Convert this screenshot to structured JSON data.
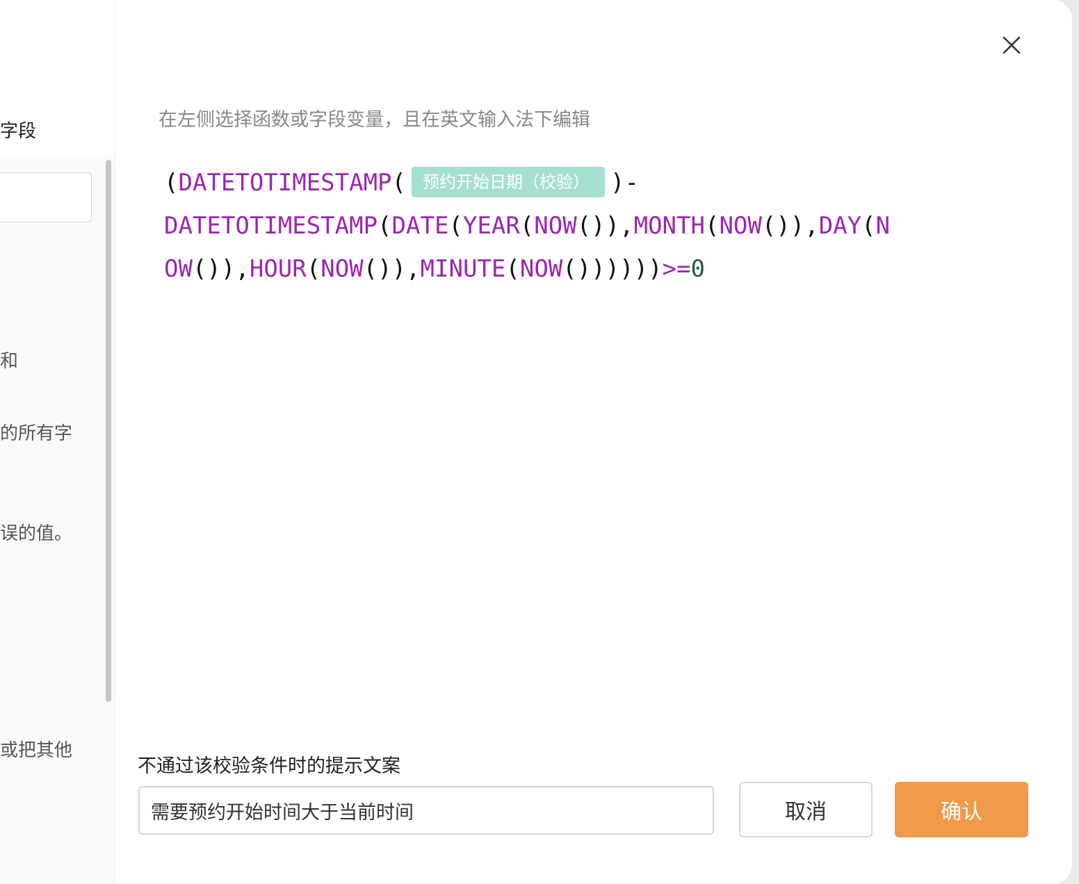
{
  "left": {
    "title_partial": "字段",
    "text_1": "和",
    "text_2": "的所有字",
    "text_3": "误的值。",
    "text_4": "或把其他"
  },
  "hint": "在左侧选择函数或字段变量，且在英文输入法下编辑",
  "formula": {
    "line1": {
      "open": "(",
      "fn": "DATETOTIMESTAMP",
      "paren": "(",
      "field_chip": "预约开始日期（校验）",
      "close": ")",
      "minus": "-"
    },
    "line2": {
      "f1": "DATETOTIMESTAMP",
      "p1": "(",
      "f2": "DATE",
      "p2": "(",
      "f3": "YEAR",
      "p3": "(",
      "f4": "NOW",
      "p4": "()),",
      "f5": "MONTH",
      "p5": "(",
      "f6": "NOW",
      "p6": "()),",
      "f7": "DAY",
      "p7": "(",
      "f8": "N"
    },
    "line3": {
      "f1": "OW",
      "p1": "()),",
      "f2": "HOUR",
      "p2": "(",
      "f3": "NOW",
      "p3": "()),",
      "f4": "MINUTE",
      "p4": "(",
      "f5": "NOW",
      "p5": "())))))",
      "op": ">=",
      "num": "0"
    }
  },
  "message": {
    "label": "不通过该校验条件时的提示文案",
    "value": "需要预约开始时间大于当前时间"
  },
  "buttons": {
    "cancel": "取消",
    "confirm": "确认"
  },
  "colors": {
    "function": "#9b26af",
    "number": "#1f5c3e",
    "chip_bg": "#a5dfd2",
    "confirm_bg": "#ef9a4b"
  }
}
